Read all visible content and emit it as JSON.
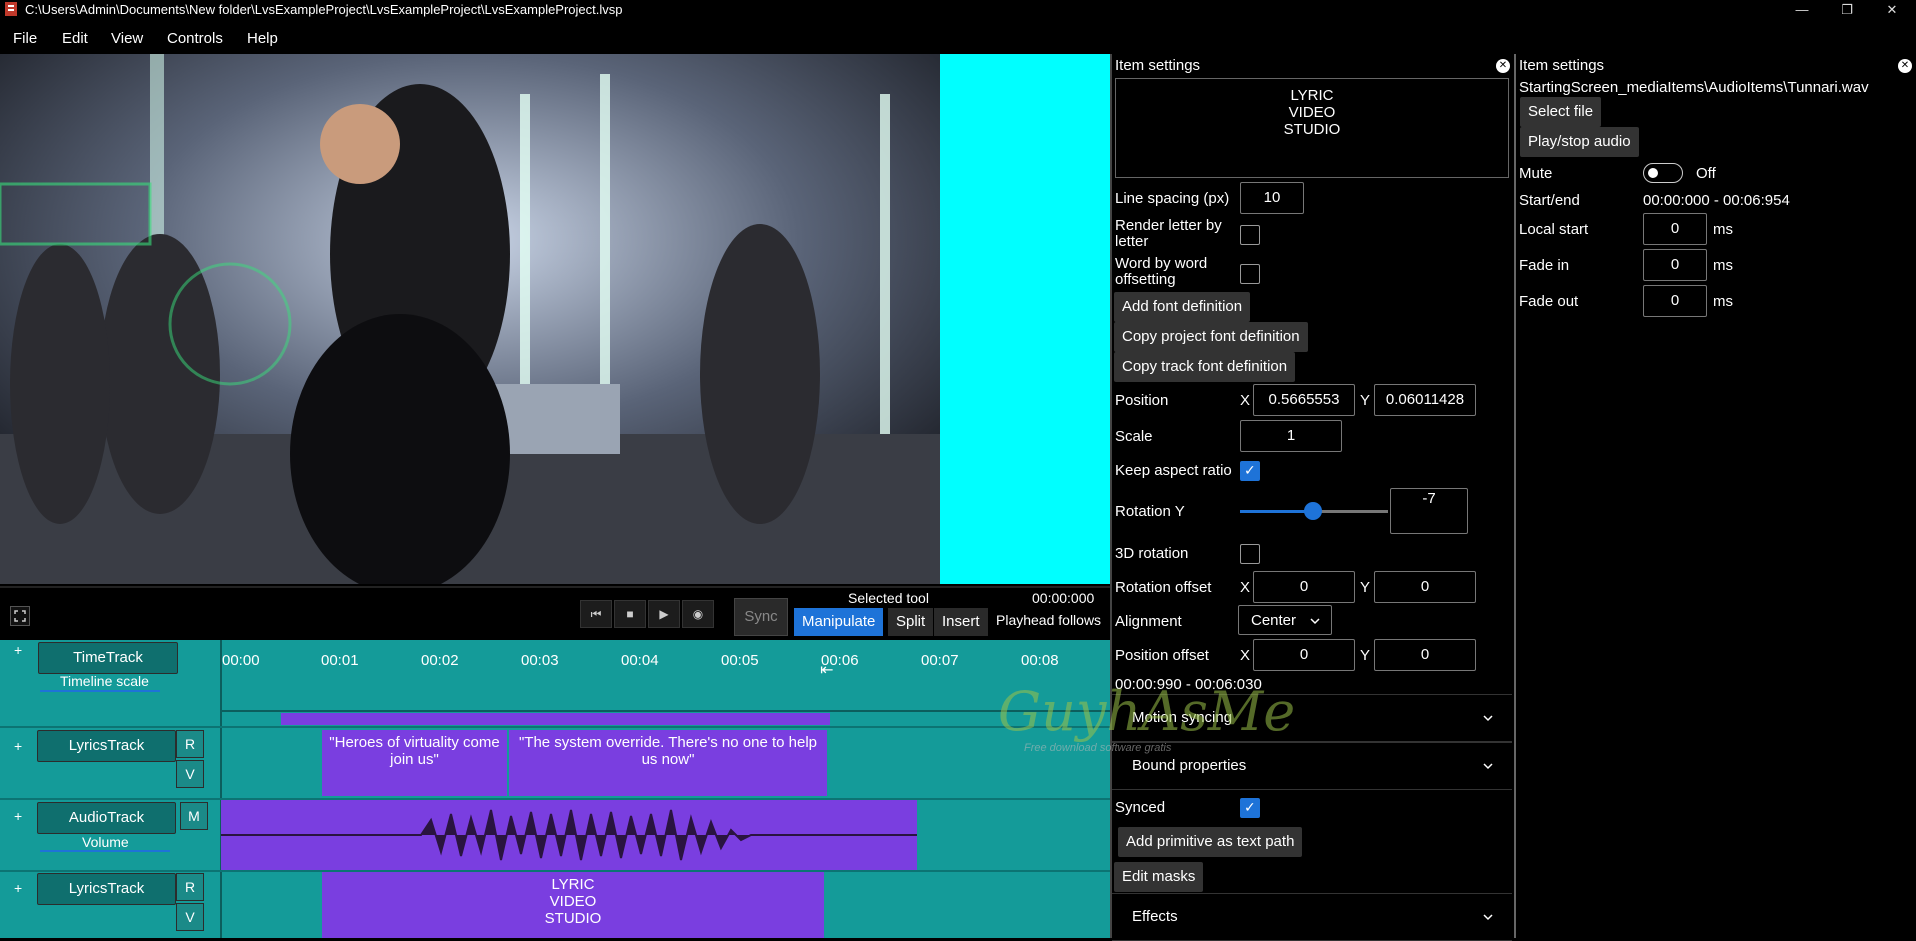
{
  "window": {
    "title": "C:\\Users\\Admin\\Documents\\New folder\\LvsExampleProject\\LvsExampleProject\\LvsExampleProject.lvsp",
    "minimize": "—",
    "maximize": "❐",
    "close": "✕"
  },
  "menu": [
    "File",
    "Edit",
    "View",
    "Controls",
    "Help"
  ],
  "transport": {
    "sync_label": "Sync",
    "selected_tool_label": "Selected tool",
    "time": "00:00:000",
    "tools": [
      "Manipulate",
      "Split",
      "Insert"
    ],
    "playhead_follows": "Playhead follows",
    "active_tool": "Manipulate"
  },
  "timeline": {
    "ticks": [
      "00:00",
      "00:01",
      "00:02",
      "00:03",
      "00:04",
      "00:05",
      "00:06",
      "00:07",
      "00:08"
    ],
    "tracks": {
      "time": {
        "name": "TimeTrack",
        "sub": "Timeline scale",
        "add": "+"
      },
      "lyrics1": {
        "name": "LyricsTrack",
        "r": "R",
        "v": "V",
        "add": "+",
        "clip1": "\"Heroes of virtuality come join us\"",
        "clip2": "\"The system override. There's no one to help us now\""
      },
      "audio": {
        "name": "AudioTrack",
        "m": "M",
        "sub": "Volume",
        "add": "+"
      },
      "lyrics2": {
        "name": "LyricsTrack",
        "r": "R",
        "v": "V",
        "add": "+",
        "clip": "LYRIC\nVIDEO\nSTUDIO"
      }
    }
  },
  "item_settings_1": {
    "header": "Item settings",
    "text_preview": "LYRIC\nVIDEO\nSTUDIO",
    "line_spacing_label": "Line spacing (px)",
    "line_spacing": "10",
    "render_letter_label": "Render letter by letter",
    "render_letter": false,
    "word_offset_label": "Word by word offsetting",
    "word_offset": false,
    "add_font_def": "Add font definition",
    "copy_project_font": "Copy project font definition",
    "copy_track_font": "Copy track font definition",
    "position_label": "Position",
    "x_label": "X",
    "y_label": "Y",
    "position_x": "0.5665553",
    "position_y": "0.06011428",
    "scale_label": "Scale",
    "scale": "1",
    "keep_aspect_label": "Keep aspect ratio",
    "keep_aspect": true,
    "rotation_y_label": "Rotation Y",
    "rotation_y": "-7",
    "rotation_y_slider_fraction": 0.49,
    "rotation_3d_label": "3D rotation",
    "rotation_3d": false,
    "rotation_offset_label": "Rotation offset",
    "rotation_offset_x": "0",
    "rotation_offset_y": "0",
    "alignment_label": "Alignment",
    "alignment": "Center",
    "position_offset_label": "Position offset",
    "position_offset_x": "0",
    "position_offset_y": "0",
    "time_range": "00:00:990 - 00:06:030",
    "motion_syncing": "Motion syncing",
    "bound_properties": "Bound properties",
    "synced_label": "Synced",
    "synced": true,
    "add_primitive": "Add primitive as text path",
    "edit_masks": "Edit masks",
    "effects": "Effects"
  },
  "item_settings_2": {
    "header": "Item settings",
    "file_path": "StartingScreen_mediaItems\\AudioItems\\Tunnari.wav",
    "select_file": "Select file",
    "play_stop": "Play/stop audio",
    "mute_label": "Mute",
    "mute_state": "Off",
    "start_end_label": "Start/end",
    "start_end": "00:00:000 - 00:06:954",
    "local_start_label": "Local start",
    "local_start": "0",
    "fade_in_label": "Fade in",
    "fade_in": "0",
    "fade_out_label": "Fade out",
    "fade_out": "0",
    "ms_unit": "ms"
  },
  "watermark": {
    "text": "GuyhAsMe",
    "tagline": "Free download software gratis"
  },
  "colors": {
    "teal": "#149b99",
    "purple": "#7a3ee0",
    "cyan": "#00ffff",
    "accent_blue": "#1e73d8"
  },
  "icons": [
    "fullscreen-icon",
    "skip-back-icon",
    "stop-icon",
    "play-icon",
    "record-icon",
    "close-icon",
    "chevron-down-icon"
  ]
}
